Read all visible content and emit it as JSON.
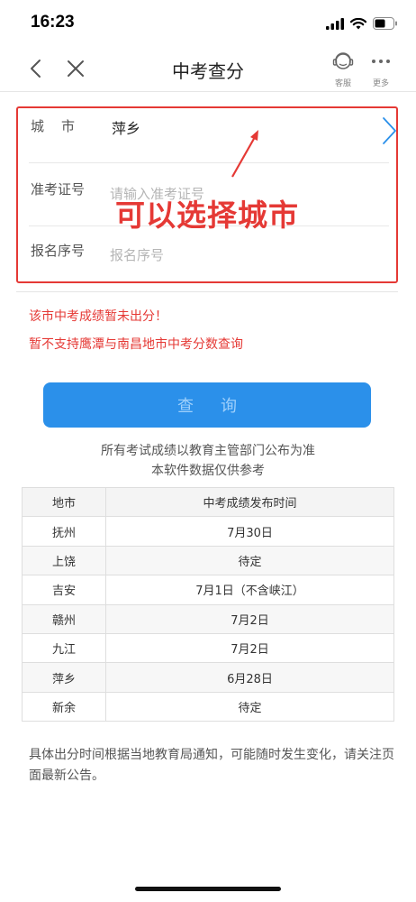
{
  "status_bar": {
    "time": "16:23"
  },
  "nav": {
    "title": "中考查分",
    "service_label": "客服",
    "more_label": "更多"
  },
  "form": {
    "city_label": "城市",
    "city_value": "萍乡",
    "exam_id_label": "准考证号",
    "exam_id_placeholder": "请输入准考证号",
    "reg_no_label": "报名序号",
    "reg_no_placeholder": "报名序号"
  },
  "annotation": {
    "text": "可以选择城市",
    "color": "#e53935"
  },
  "warnings": [
    "该市中考成绩暂未出分！",
    "暂不支持鹰潭与南昌地市中考分数查询"
  ],
  "query_button": {
    "label": "查询",
    "color": "#2b90ea"
  },
  "notice": [
    "所有考试成绩以教育主管部门公布为准",
    "本软件数据仅供参考"
  ],
  "table": {
    "headers": [
      "地市",
      "中考成绩发布时间"
    ],
    "rows": [
      [
        "抚州",
        "7月30日"
      ],
      [
        "上饶",
        "待定"
      ],
      [
        "吉安",
        "7月1日（不含峡江）"
      ],
      [
        "赣州",
        "7月2日"
      ],
      [
        "九江",
        "7月2日"
      ],
      [
        "萍乡",
        "6月28日"
      ],
      [
        "新余",
        "待定"
      ]
    ]
  },
  "footer_note": "具体出分时间根据当地教育局通知，可能随时发生变化，请关注页面最新公告。"
}
